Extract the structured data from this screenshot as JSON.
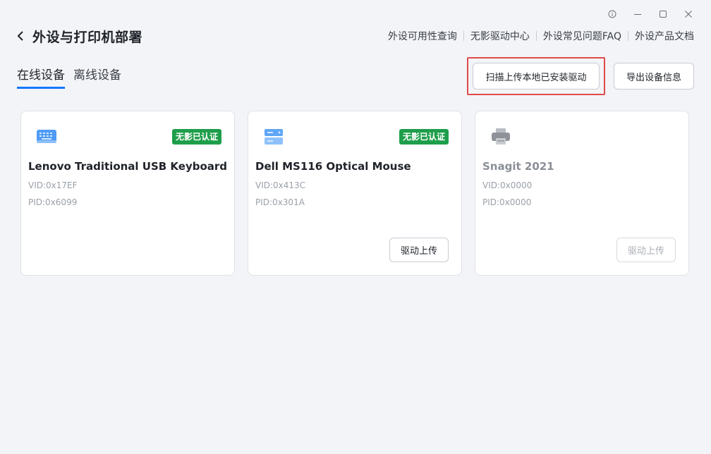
{
  "window": {
    "info_icon": "info-icon",
    "minimize_icon": "minimize-icon",
    "maximize_icon": "maximize-icon",
    "close_icon": "close-icon"
  },
  "header": {
    "title": "外设与打印机部署",
    "links": [
      "外设可用性查询",
      "无影驱动中心",
      "外设常见问题FAQ",
      "外设产品文档"
    ]
  },
  "tabs": [
    {
      "label": "在线设备",
      "active": true
    },
    {
      "label": "离线设备",
      "active": false
    }
  ],
  "actions": {
    "scan_label": "扫描上传本地已安装驱动",
    "export_label": "导出设备信息"
  },
  "devices": [
    {
      "icon": "keyboard-icon",
      "badge": "无影已认证",
      "name": "Lenovo Traditional USB Keyboard",
      "vid": "VID:0x17EF",
      "pid": "PID:0x6099",
      "button": ""
    },
    {
      "icon": "mouse-icon",
      "badge": "无影已认证",
      "name": "Dell MS116 Optical Mouse",
      "vid": "VID:0x413C",
      "pid": "PID:0x301A",
      "button": "驱动上传"
    },
    {
      "icon": "printer-icon",
      "badge": "",
      "name": "Snagit 2021",
      "vid": "VID:0x0000",
      "pid": "PID:0x0000",
      "button": "驱动上传"
    }
  ],
  "colors": {
    "accent": "#1677ff",
    "badge_green": "#1e9e4a",
    "highlight_red": "#e04a4a"
  }
}
